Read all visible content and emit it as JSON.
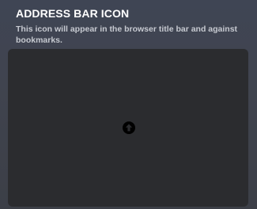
{
  "panel": {
    "title": "ADDRESS BAR ICON",
    "description": "This icon will appear in the browser title bar and against bookmarks."
  },
  "dropzone": {
    "icon": "upload-arrow-icon"
  },
  "colors": {
    "title_text": "#ffffff",
    "description_text": "#c6c9d0",
    "background": "#40444f",
    "dropzone_background": "#2b2c2f",
    "icon": "#000000"
  }
}
